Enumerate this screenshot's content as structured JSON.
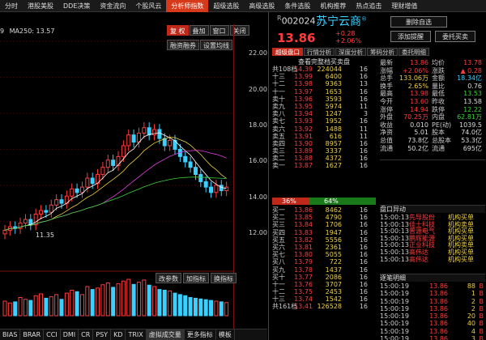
{
  "menu": [
    "分时",
    "港股美股",
    "DDE决策",
    "资金流向",
    "个股风云",
    "分析师指数",
    "超级选股",
    "高级选股",
    "条件选股",
    "机构推荐",
    "热点追击",
    "理财增值"
  ],
  "menu_active_index": 5,
  "toolbar": {
    "fuquan": "复 权",
    "overlay": "叠加",
    "window": "窗口",
    "close": "关闭",
    "overlay_hist": "叠加历史",
    "draw": "画线",
    "sub1": "融资融券",
    "sub2": "设置均线"
  },
  "ma": {
    "pre": "9",
    "ma250_label": "MA250: 13.57"
  },
  "price_axis": [
    "22.00",
    "20.00",
    "18.00",
    "16.00",
    "14.00",
    "12.00"
  ],
  "chart_low_label": "11.35",
  "date_axis": [
    "09",
    "10",
    "11",
    "12"
  ],
  "indicator_buttons": [
    "改参数",
    "加指标",
    "换指标"
  ],
  "bottom_tabs": [
    "BIAS",
    "BRAR",
    "CCI",
    "DMI",
    "CR",
    "PSY",
    "KD",
    "TRIX",
    "虚拟成交量",
    "更多指标",
    "模板"
  ],
  "bottom_selected": 8,
  "chart_data": {
    "type": "candlestick",
    "ylim": [
      10.8,
      22.5
    ],
    "closes": [
      11.5,
      11.7,
      11.6,
      11.9,
      12.1,
      11.8,
      12.4,
      12.6,
      12.5,
      12.9,
      13.2,
      13.0,
      13.4,
      13.8,
      13.6,
      13.9,
      14.4,
      14.1,
      14.6,
      15.0,
      15.4,
      15.1,
      15.6,
      16.2,
      16.8,
      16.4,
      16.9,
      17.2,
      16.8,
      17.1,
      16.6,
      16.2,
      16.5,
      16.0,
      15.6,
      15.3,
      15.0,
      14.6,
      14.2,
      13.9,
      13.6,
      14.0,
      13.7,
      13.9
    ],
    "volumes": [
      40,
      35,
      38,
      50,
      45,
      42,
      55,
      60,
      48,
      52,
      58,
      45,
      62,
      70,
      66,
      58,
      80,
      72,
      76,
      85,
      90,
      78,
      88,
      95,
      100,
      86,
      92,
      98,
      84,
      80,
      72,
      70,
      68,
      62,
      58,
      55,
      50,
      48,
      46,
      44,
      42,
      40,
      38,
      36
    ]
  },
  "stock": {
    "code": "002024",
    "code_prefix": "R",
    "name": "苏宁云商",
    "name_mark": "®",
    "price": "13.86",
    "chg_abs": "+0.28",
    "chg_pct": "+2.06%"
  },
  "right_buttons": [
    "删除自选",
    "添加提醒",
    "委托买卖"
  ],
  "tabs": [
    "超级盘口",
    "行情分析",
    "深度分析",
    "筹码分析",
    "委托明细"
  ],
  "ob_title": "查看完整档买卖盘",
  "ob_head": {
    "label": "共108档",
    "price": "14.39",
    "vol": "224044",
    "cnt": "16"
  },
  "asks": [
    {
      "l": "十三",
      "p": "13.99",
      "v": "6400",
      "c": "16"
    },
    {
      "l": "十二",
      "p": "13.98",
      "v": "9363",
      "c": "13"
    },
    {
      "l": "十一",
      "p": "13.97",
      "v": "1653",
      "c": "16"
    },
    {
      "l": "卖十",
      "p": "13.96",
      "v": "3593",
      "c": "16"
    },
    {
      "l": "卖九",
      "p": "13.95",
      "v": "5974",
      "c": "11"
    },
    {
      "l": "卖八",
      "p": "13.94",
      "v": "1247",
      "c": "3"
    },
    {
      "l": "卖七",
      "p": "13.93",
      "v": "1952",
      "c": "16"
    },
    {
      "l": "卖六",
      "p": "13.92",
      "v": "1488",
      "c": "11"
    },
    {
      "l": "卖五",
      "p": "13.91",
      "v": "616",
      "c": "11"
    },
    {
      "l": "卖四",
      "p": "13.90",
      "v": "8957",
      "c": "16"
    },
    {
      "l": "卖三",
      "p": "13.89",
      "v": "3337",
      "c": "16"
    },
    {
      "l": "卖二",
      "p": "13.88",
      "v": "4372",
      "c": "16"
    },
    {
      "l": "卖一",
      "p": "13.87",
      "v": "1627",
      "c": "16"
    }
  ],
  "ratio": {
    "bid": "36%",
    "ask": "64%",
    "bid_frac": 0.36
  },
  "bids": [
    {
      "l": "买一",
      "p": "13.86",
      "v": "8462",
      "c": "16"
    },
    {
      "l": "买二",
      "p": "13.85",
      "v": "4790",
      "c": "16"
    },
    {
      "l": "买三",
      "p": "13.84",
      "v": "1706",
      "c": "16"
    },
    {
      "l": "买四",
      "p": "13.83",
      "v": "1947",
      "c": "16"
    },
    {
      "l": "买五",
      "p": "13.82",
      "v": "5556",
      "c": "16"
    },
    {
      "l": "买六",
      "p": "13.81",
      "v": "2361",
      "c": "16"
    },
    {
      "l": "买七",
      "p": "13.80",
      "v": "5055",
      "c": "16"
    },
    {
      "l": "买八",
      "p": "13.79",
      "v": "722",
      "c": "16"
    },
    {
      "l": "买九",
      "p": "13.78",
      "v": "1437",
      "c": "16"
    },
    {
      "l": "买十",
      "p": "13.77",
      "v": "2086",
      "c": "16"
    },
    {
      "l": "十一",
      "p": "13.76",
      "v": "3707",
      "c": "16"
    },
    {
      "l": "十二",
      "p": "13.75",
      "v": "2453",
      "c": "16"
    },
    {
      "l": "十三",
      "p": "13.74",
      "v": "1542",
      "c": "16"
    }
  ],
  "ob_foot": {
    "label": "共161档",
    "price": "13.41",
    "vol": "126528",
    "cnt": "16"
  },
  "stats": [
    {
      "k": "最新",
      "v": "13.86",
      "vc": "red",
      "k2": "均价",
      "v2": "13.78",
      "v2c": "red"
    },
    {
      "k": "涨幅",
      "v": "+2.06%",
      "vc": "red",
      "k2": "涨跌",
      "v2": "▲ 0.28",
      "v2c": "red"
    },
    {
      "k": "总手",
      "v": "133.06万",
      "vc": "yellow",
      "k2": "金额",
      "v2": "18.34亿",
      "v2c": "cyan"
    },
    {
      "k": "换手",
      "v": "2.65%",
      "vc": "yellow",
      "k2": "量比",
      "v2": "0.76",
      "v2c": "white"
    },
    {
      "k": "最高",
      "v": "13.98",
      "vc": "red",
      "k2": "最低",
      "v2": "13.53",
      "v2c": "green"
    },
    {
      "k": "今开",
      "v": "13.60",
      "vc": "red",
      "k2": "昨收",
      "v2": "13.58",
      "v2c": "white"
    },
    {
      "k": "涨停",
      "v": "14.94",
      "vc": "red",
      "k2": "跌停",
      "v2": "12.22",
      "v2c": "green"
    },
    {
      "k": "外盘",
      "v": "70.25万",
      "vc": "red",
      "k2": "内盘",
      "v2": "62.81万",
      "v2c": "green"
    },
    {
      "k": "收益",
      "v": "0.010",
      "vc": "white",
      "k2": "PE(动)",
      "v2": "1039.5",
      "v2c": "white"
    },
    {
      "k": "净资",
      "v": "5.01",
      "vc": "white",
      "k2": "股本",
      "v2": "74.0亿",
      "v2c": "white"
    },
    {
      "k": "总值",
      "v": "73.8亿",
      "vc": "white",
      "k2": "总股本",
      "v2": "53.3亿",
      "v2c": "white"
    },
    {
      "k": "流通",
      "v": "50.2亿",
      "vc": "white",
      "k2": "流通",
      "v2": "695亿",
      "v2c": "white"
    }
  ],
  "events_title": "盘口异动",
  "events": [
    {
      "t": "15:00:13",
      "n": "先导股份",
      "x": "机构买单"
    },
    {
      "t": "15:00:13",
      "n": "佳士科技",
      "x": "机构卖单"
    },
    {
      "t": "15:00:13",
      "n": "普源电气",
      "x": "机构买单"
    },
    {
      "t": "15:00:13",
      "n": "鹏辉能源",
      "x": "机构买单"
    },
    {
      "t": "15:00:13",
      "n": "正业科技",
      "x": "机构卖单"
    },
    {
      "t": "15:00:13",
      "n": "高伟达",
      "x": "机构买单"
    },
    {
      "t": "15:00:13",
      "n": "高伟达",
      "x": "机构买单"
    }
  ],
  "trades_title": "逐笔明细",
  "trades": [
    {
      "t": "15:00:19",
      "p": "13.86",
      "v": "88",
      "d": "B"
    },
    {
      "t": "15:00:19",
      "p": "13.86",
      "v": "1",
      "d": "B"
    },
    {
      "t": "15:00:19",
      "p": "13.86",
      "v": "2",
      "d": "B"
    },
    {
      "t": "15:00:19",
      "p": "13.86",
      "v": "2",
      "d": "B"
    },
    {
      "t": "15:00:19",
      "p": "13.86",
      "v": "20",
      "d": "B"
    },
    {
      "t": "15:00:19",
      "p": "13.86",
      "v": "40",
      "d": "B"
    },
    {
      "t": "15:00:19",
      "p": "13.86",
      "v": "4",
      "d": "B"
    },
    {
      "t": "15:00:19",
      "p": "13.86",
      "v": "3",
      "d": "B"
    },
    {
      "t": "15:00:19",
      "p": "13.86",
      "v": "5",
      "d": "B"
    }
  ]
}
